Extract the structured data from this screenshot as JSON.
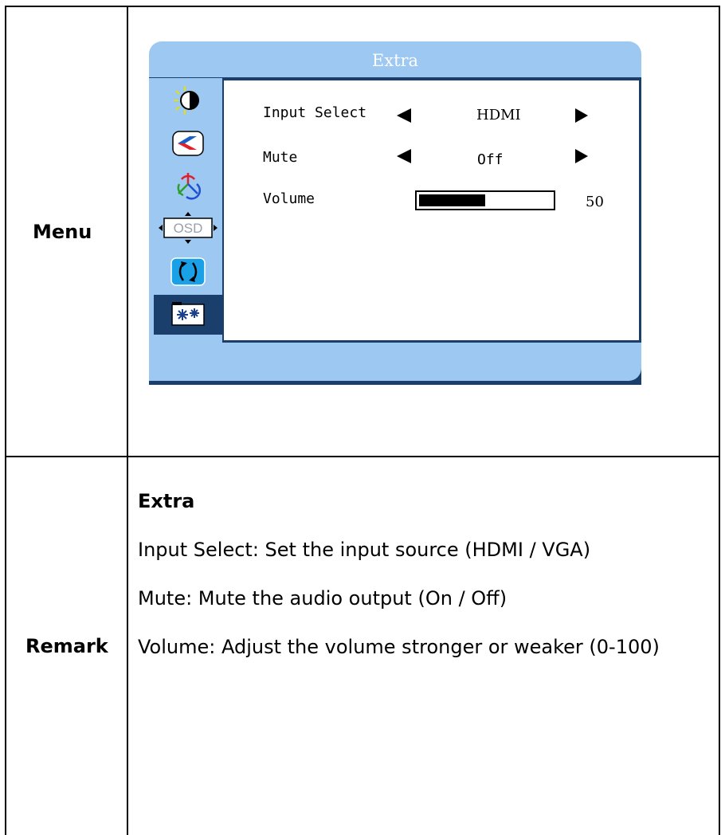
{
  "table": {
    "menu_label": "Menu",
    "remark_label": "Remark"
  },
  "osd": {
    "title": "Extra",
    "icons": [
      "brightness-contrast-icon",
      "image-adjust-icon",
      "color-icon",
      "osd-icon",
      "reset-icon",
      "extra-icon"
    ],
    "icon_texts": {
      "osd": "OSD"
    },
    "selected_icon_index": 5,
    "options": [
      {
        "label": "Input Select",
        "value": "HDMI"
      },
      {
        "label": "Mute",
        "value": "Off"
      },
      {
        "label": "Volume",
        "value": "50"
      }
    ],
    "volume_level": 0.5,
    "colors": {
      "frame": "#9cc8f2",
      "border": "#1a3f6d",
      "panel": "#ffffff"
    }
  },
  "remark": {
    "heading": "Extra",
    "lines": [
      "Input Select: Set the input source (HDMI / VGA)",
      "Mute: Mute the audio output (On / Off)",
      "Volume: Adjust the volume stronger or weaker (0-100)"
    ]
  }
}
